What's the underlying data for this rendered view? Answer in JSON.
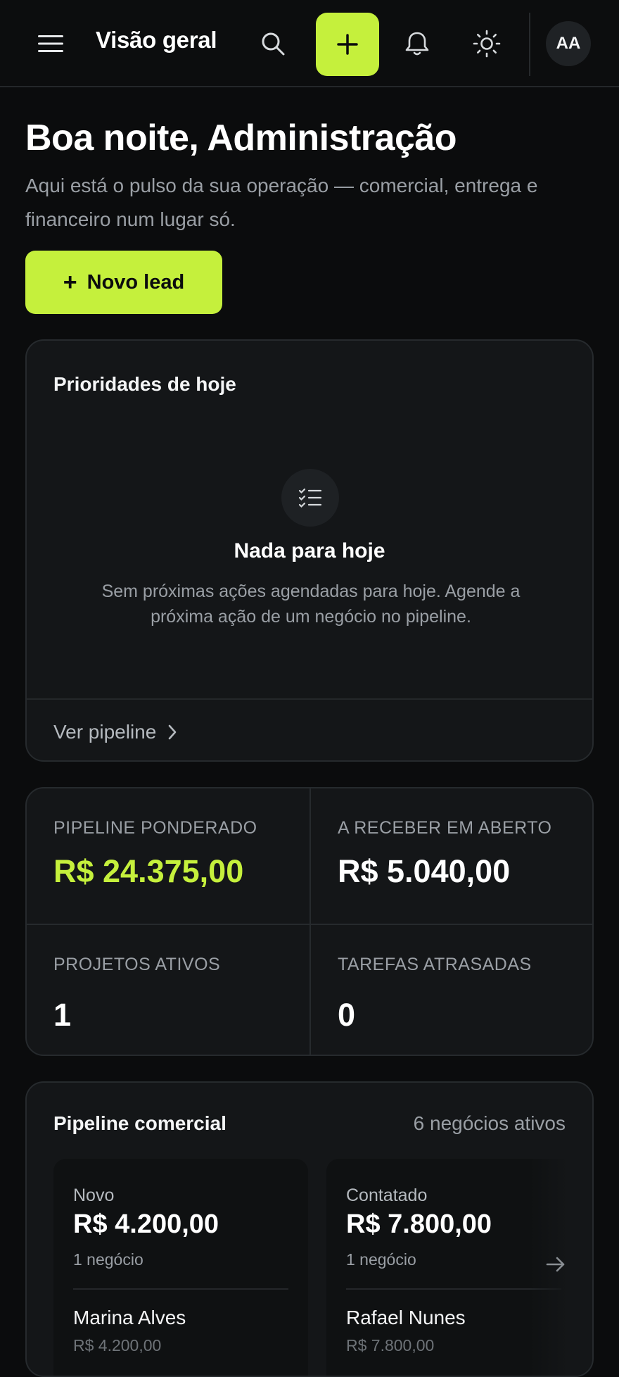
{
  "topbar": {
    "title": "Visão geral",
    "avatar_initials": "AA",
    "icons": [
      "menu-icon",
      "search-icon",
      "plus-icon",
      "bell-icon",
      "sun-icon"
    ]
  },
  "greeting": {
    "title": "Boa noite, Administração",
    "subtitle": "Aqui está o pulso da sua operação — comercial, entrega e financeiro num lugar só."
  },
  "new_lead": {
    "plus": "+",
    "label": "Novo lead"
  },
  "priorities": {
    "title": "Prioridades de hoje",
    "empty_title": "Nada para hoje",
    "empty_desc": "Sem próximas ações agendadas para hoje. Agende a próxima ação de um negócio no pipeline.",
    "link": "Ver pipeline"
  },
  "stats": [
    {
      "label": "Pipeline ponderado",
      "value": "R$ 24.375,00"
    },
    {
      "label": "A receber em aberto",
      "value": "R$ 5.040,00"
    },
    {
      "label": "Projetos ativos",
      "value": "1"
    },
    {
      "label": "Tarefas atrasadas",
      "value": "0"
    }
  ],
  "pipeline": {
    "title": "Pipeline comercial",
    "count": "6 negócios ativos",
    "stages": [
      {
        "name": "Novo",
        "amount": "R$ 4.200,00",
        "deals": "1 negócio",
        "deal_name": "Marina Alves",
        "deal_value": "R$ 4.200,00"
      },
      {
        "name": "Contatado",
        "amount": "R$ 7.800,00",
        "deals": "1 negócio",
        "deal_name": "Rafael Nunes",
        "deal_value": "R$ 7.800,00"
      }
    ]
  },
  "colors": {
    "accent": "#c5f03c",
    "background": "#0b0c0d",
    "card": "#141618",
    "muted_text": "#9a9fa5"
  }
}
